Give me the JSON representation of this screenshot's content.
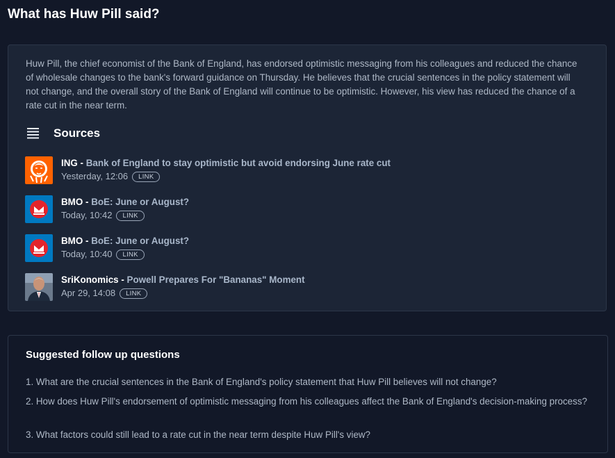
{
  "page": {
    "title": "What has Huw Pill said?"
  },
  "answer": {
    "text": "Huw Pill, the chief economist of the Bank of England, has endorsed optimistic messaging from his colleagues and reduced the chance of wholesale changes to the bank's forward guidance on Thursday. He believes that the crucial sentences in the policy statement will not change, and the overall story of the Bank of England will continue to be optimistic. However, his view has reduced the chance of a rate cut in the near term."
  },
  "sources": {
    "heading": "Sources",
    "icon": "list-icon",
    "items": [
      {
        "publisher": "ING",
        "separator": "-",
        "title": "Bank of England to stay optimistic but avoid endorsing June rate cut",
        "time": "Yesterday, 12:06",
        "link_label": "LINK",
        "logo": "ing-lion-logo"
      },
      {
        "publisher": "BMO",
        "separator": "-",
        "title": "BoE: June or August?",
        "time": "Today, 10:42",
        "link_label": "LINK",
        "logo": "bmo-logo"
      },
      {
        "publisher": "BMO",
        "separator": "-",
        "title": "BoE: June or August?",
        "time": "Today, 10:40",
        "link_label": "LINK",
        "logo": "bmo-logo"
      },
      {
        "publisher": "SriKonomics",
        "separator": "-",
        "title": "Powell Prepares For \"Bananas\" Moment",
        "time": "Apr 29, 14:08",
        "link_label": "LINK",
        "logo": "author-photo"
      }
    ]
  },
  "followup": {
    "heading": "Suggested follow up questions",
    "questions": [
      "1. What are the crucial sentences in the Bank of England's policy statement that Huw Pill believes will not change?",
      "2. How does Huw Pill's endorsement of optimistic messaging from his colleagues affect the Bank of England's decision-making process?",
      "3. What factors could still lead to a rate cut in the near term despite Huw Pill's view?"
    ]
  },
  "colors": {
    "background": "#121828",
    "card": "#1c2536",
    "ing_orange": "#ff6200",
    "bmo_blue": "#0079c1",
    "bmo_red": "#e3242b"
  }
}
